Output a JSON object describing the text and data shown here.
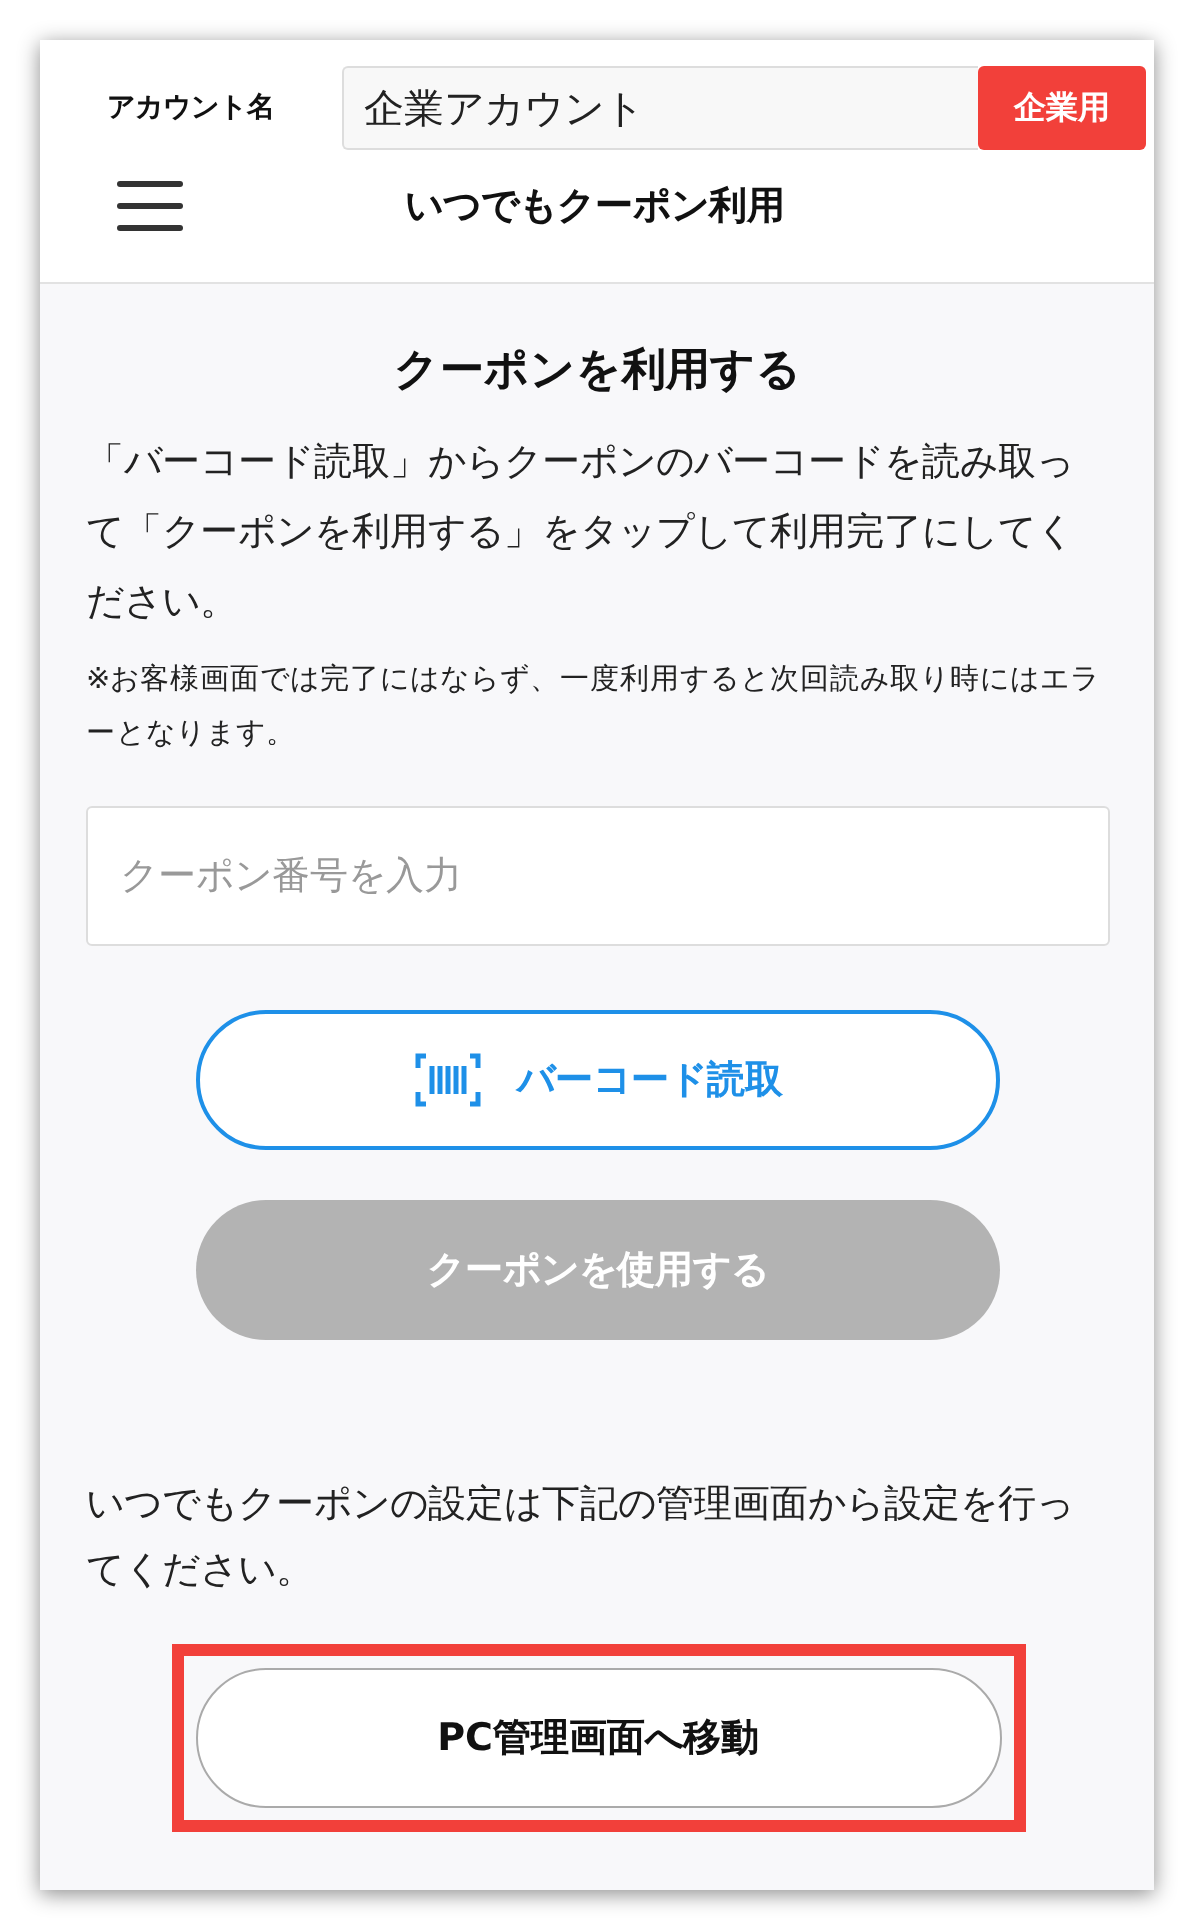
{
  "header": {
    "account_label": "アカウント名",
    "account_value": "企業アカウント",
    "account_badge": "企業用",
    "title": "いつでもクーポン利用"
  },
  "main": {
    "heading": "クーポンを利用する",
    "description": "「バーコード読取」からクーポンのバーコードを読み取って「クーポンを利用する」をタップして利用完了にしてください。",
    "note": "※お客様画面では完了にはならず、一度利用すると次回読み取り時にはエラーとなります。",
    "coupon_field": {
      "placeholder": "クーポン番号を入力"
    },
    "scan_button": {
      "label": "バーコード読取"
    },
    "use_button": {
      "label": "クーポンを使用する",
      "disabled": true
    },
    "settings_text": "いつでもクーポンの設定は下記の管理画面から設定を行ってください。",
    "admin_button": {
      "label": "PC管理画面へ移動",
      "highlighted": true
    }
  }
}
